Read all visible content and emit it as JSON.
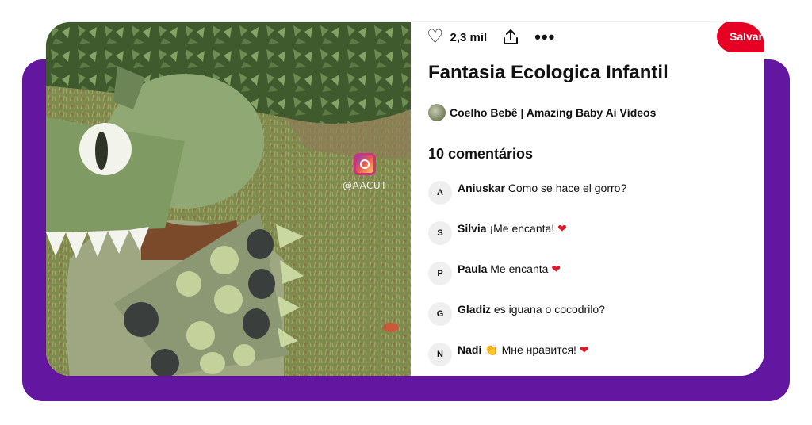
{
  "video": {
    "watermark_text": "@AACUT"
  },
  "actions": {
    "like_count": "2,3 mil",
    "save_label": "Salvar"
  },
  "pin": {
    "title": "Fantasia Ecologica Infantil",
    "author": "Coelho Bebê | Amazing Baby Ai Vídeos"
  },
  "comments": {
    "heading": "10 comentários",
    "items": [
      {
        "initial": "A",
        "name": "Aniuskar",
        "text": "Como se hace el gorro?",
        "emoji": ""
      },
      {
        "initial": "S",
        "name": "Silvia",
        "text": "¡Me encanta!",
        "emoji": "❤"
      },
      {
        "initial": "P",
        "name": "Paula",
        "text": "Me encanta",
        "emoji": "❤"
      },
      {
        "initial": "G",
        "name": "Gladiz",
        "text": "es iguana o cocodrilo?",
        "emoji": ""
      },
      {
        "initial": "N",
        "name": "Nadi",
        "prefix_emoji": "👏",
        "text": "Мне нравится!",
        "emoji": "❤"
      }
    ]
  },
  "colors": {
    "brand_purple": "#63169f",
    "save_red": "#e60023",
    "heart_red": "#e0162b"
  }
}
